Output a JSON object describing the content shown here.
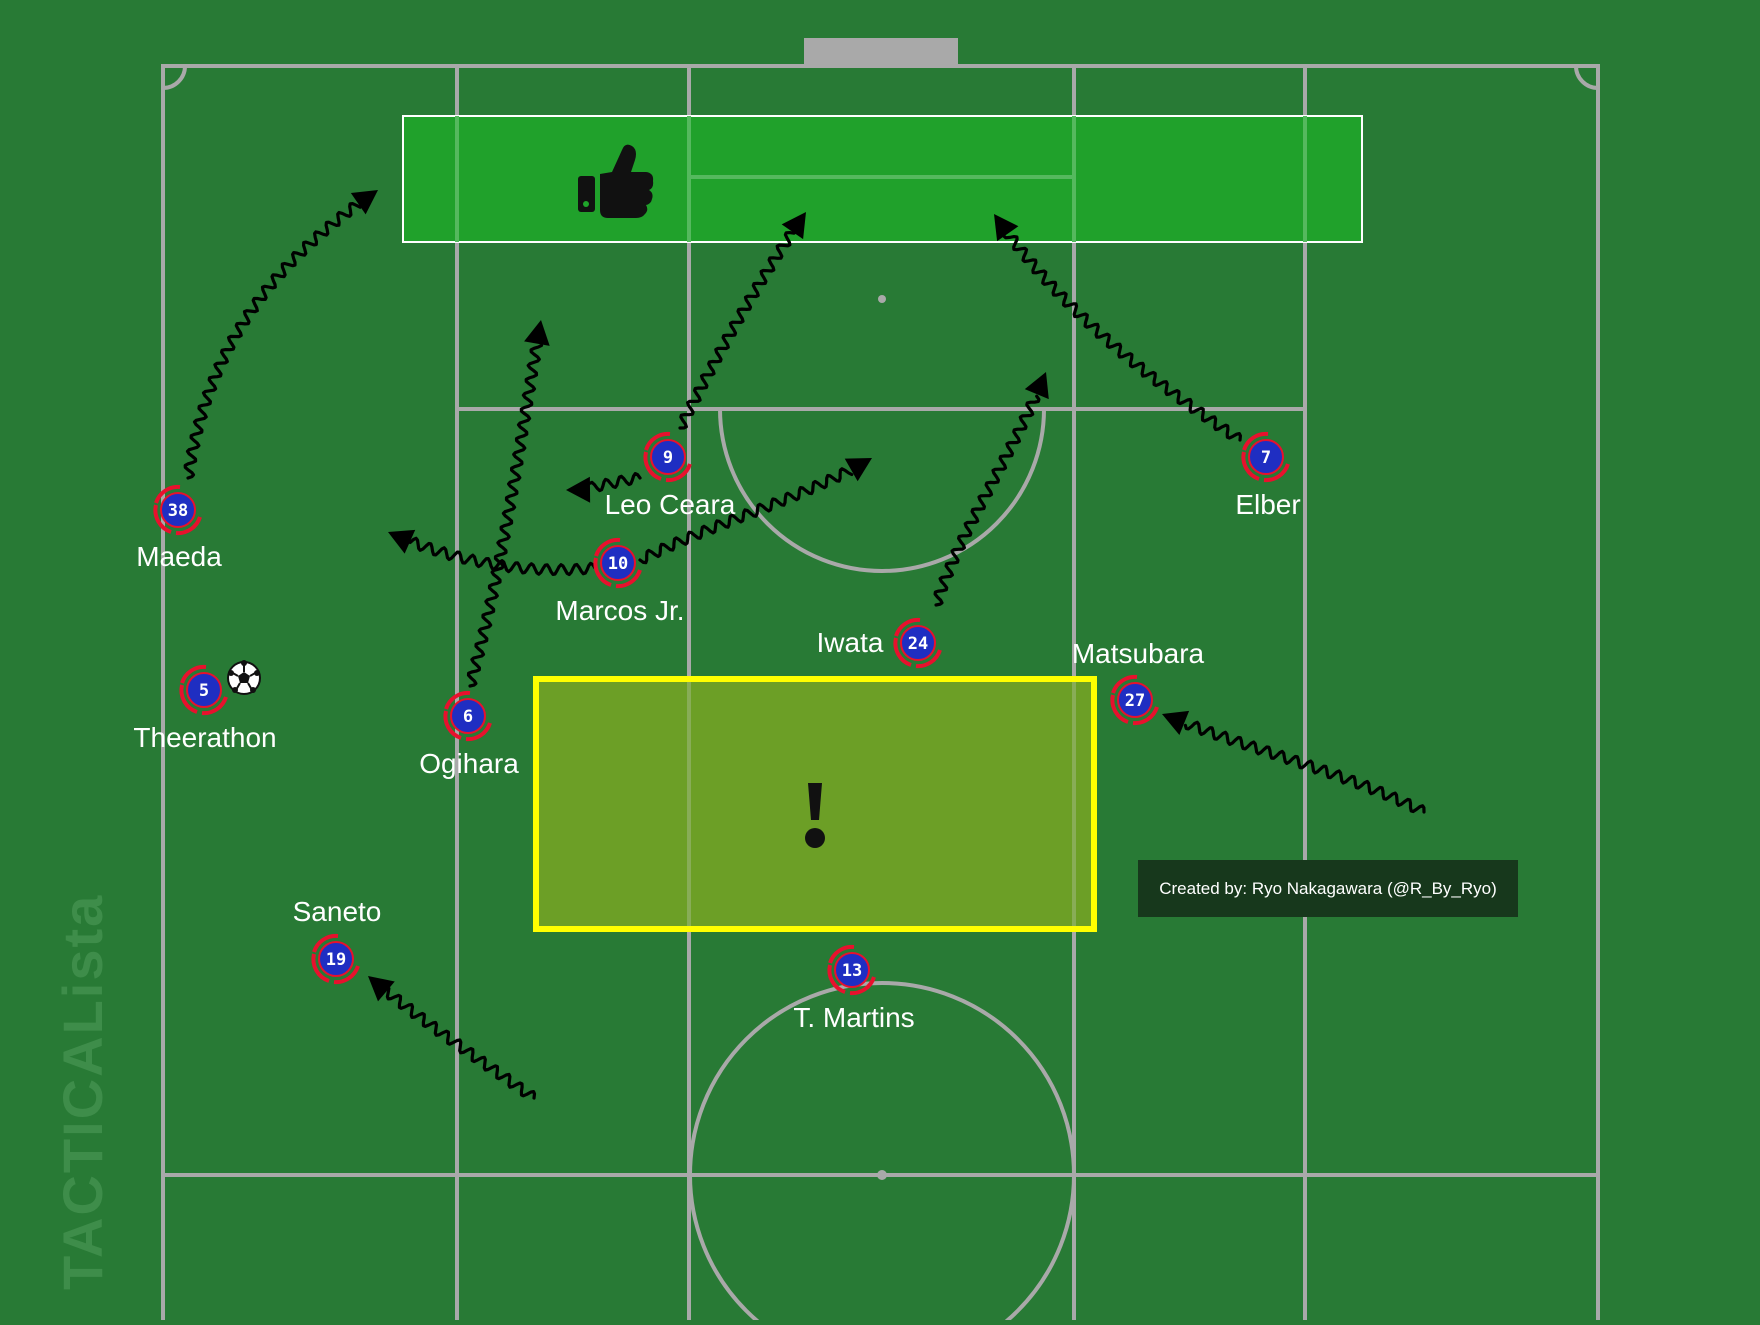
{
  "players": [
    {
      "id": "maeda",
      "number": "38",
      "name": "Maeda"
    },
    {
      "id": "leo-ceara",
      "number": "9",
      "name": "Leo Ceara"
    },
    {
      "id": "elber",
      "number": "7",
      "name": "Elber"
    },
    {
      "id": "marcos-jr",
      "number": "10",
      "name": "Marcos Jr."
    },
    {
      "id": "iwata",
      "number": "24",
      "name": "Iwata"
    },
    {
      "id": "matsubara",
      "number": "27",
      "name": "Matsubara"
    },
    {
      "id": "theerathon",
      "number": "5",
      "name": "Theerathon"
    },
    {
      "id": "ogihara",
      "number": "6",
      "name": "Ogihara"
    },
    {
      "id": "saneto",
      "number": "19",
      "name": "Saneto"
    },
    {
      "id": "t-martins",
      "number": "13",
      "name": "T. Martins"
    }
  ],
  "zones": {
    "positive": {
      "icon": "thumbs-up-icon",
      "color": "#1fa52a"
    },
    "danger": {
      "icon": "exclamation-icon",
      "color": "#ffff00"
    }
  },
  "credit": "Created by: Ryo Nakagawara (@R_By_Ryo)",
  "watermark": "TACTICALista",
  "colors": {
    "pitch": "#287a35",
    "lines": "#a9a9a9",
    "player_fill": "#1f2ec2",
    "player_ring": "#e8112d",
    "arrows": "#000000"
  }
}
